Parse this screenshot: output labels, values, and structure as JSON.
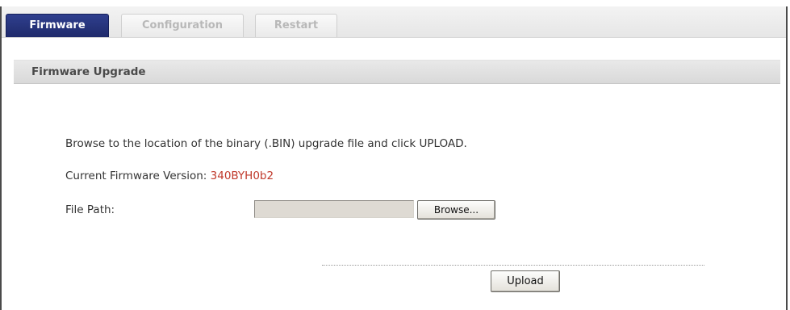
{
  "figure_label": "",
  "tabs": [
    {
      "label": "Firmware",
      "active": true
    },
    {
      "label": "Configuration",
      "active": false
    },
    {
      "label": "Restart",
      "active": false
    }
  ],
  "section": {
    "title": "Firmware Upgrade"
  },
  "instructions": "Browse to the location of the binary (.BIN) upgrade file and click UPLOAD.",
  "firmware": {
    "label": "Current Firmware Version: ",
    "version": "340BYH0b2",
    "version_color": "#c0392b"
  },
  "file_path": {
    "label": "File Path:",
    "value": "",
    "browse_label": "Browse..."
  },
  "upload_label": "Upload",
  "colors": {
    "active_tab": "#25317a",
    "section_header": "#dedede"
  }
}
